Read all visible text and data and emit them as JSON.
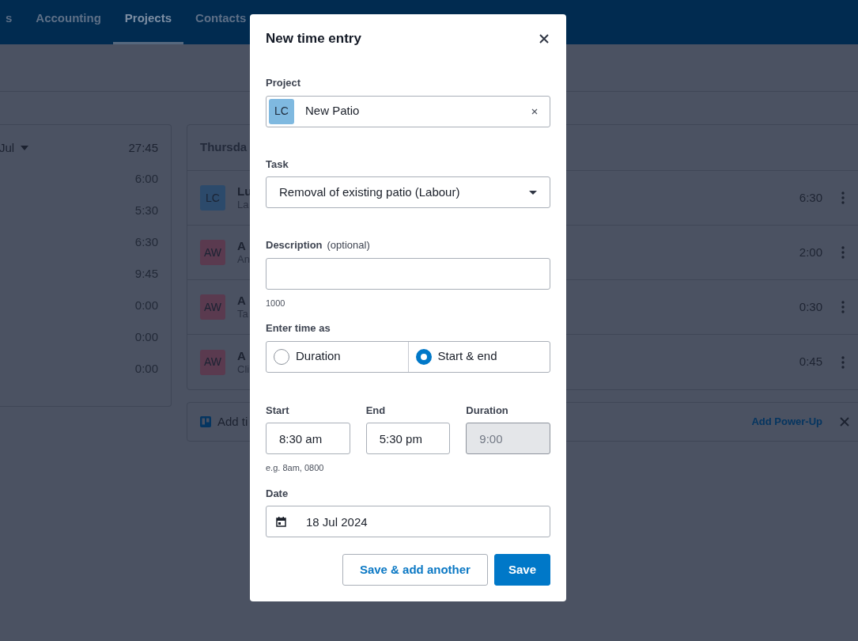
{
  "nav": {
    "items": [
      {
        "label": "s",
        "selected": false
      },
      {
        "label": "Accounting",
        "selected": false
      },
      {
        "label": "Projects",
        "selected": true
      },
      {
        "label": "Contacts",
        "selected": false
      }
    ]
  },
  "week_panel": {
    "header": "Jul",
    "total": "27:45",
    "day_totals": [
      "6:00",
      "5:30",
      "6:30",
      "9:45",
      "0:00",
      "0:00",
      "0:00"
    ]
  },
  "day_panel": {
    "title": "Thursda",
    "entries": [
      {
        "initials": "LC",
        "color": "#2c4a6b",
        "name": "Lu",
        "detail": "La",
        "time": "6:30"
      },
      {
        "initials": "AW",
        "color": "#5a3a4f",
        "name": "A",
        "detail": "An",
        "time": "2:00"
      },
      {
        "initials": "AW",
        "color": "#5a3a4f",
        "name": "A",
        "detail": "Ta",
        "time": "0:30"
      },
      {
        "initials": "AW",
        "color": "#5a3a4f",
        "name": "A",
        "detail": "Cli",
        "time": "0:45"
      }
    ]
  },
  "powerup_bar": {
    "text": "Add ti",
    "link": "Add Power-Up"
  },
  "modal": {
    "title": "New time entry",
    "project": {
      "label": "Project",
      "initials": "LC",
      "color": "#7fb9e0",
      "value": "New Patio"
    },
    "task": {
      "label": "Task",
      "value": "Removal of existing patio (Labour)"
    },
    "description": {
      "label": "Description",
      "note": "(optional)",
      "counter": "1000"
    },
    "time_mode": {
      "label": "Enter time as",
      "options": [
        {
          "label": "Duration",
          "selected": false
        },
        {
          "label": "Start & end",
          "selected": true
        }
      ]
    },
    "start": {
      "label": "Start",
      "value": "8:30 am",
      "hint": "e.g. 8am, 0800"
    },
    "end": {
      "label": "End",
      "value": "5:30 pm"
    },
    "duration": {
      "label": "Duration",
      "value": "9:00",
      "disabled": true
    },
    "date": {
      "label": "Date",
      "value": "18 Jul 2024"
    },
    "buttons": [
      {
        "label": "Save & add another",
        "kind": "secondary"
      },
      {
        "label": "Save",
        "kind": "primary"
      }
    ]
  }
}
